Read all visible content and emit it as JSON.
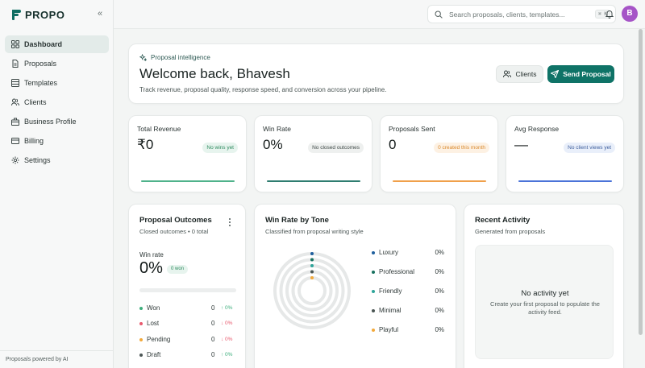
{
  "brand": {
    "name": "PROPO",
    "collapse_icon": "«"
  },
  "sidebar": {
    "items": [
      {
        "label": "Dashboard",
        "icon": "grid-icon",
        "active": true
      },
      {
        "label": "Proposals",
        "icon": "file-icon",
        "active": false
      },
      {
        "label": "Templates",
        "icon": "template-icon",
        "active": false
      },
      {
        "label": "Clients",
        "icon": "users-icon",
        "active": false
      },
      {
        "label": "Business Profile",
        "icon": "building-icon",
        "active": false
      },
      {
        "label": "Billing",
        "icon": "card-icon",
        "active": false
      },
      {
        "label": "Settings",
        "icon": "gear-icon",
        "active": false
      }
    ],
    "footer": "Proposals powered by AI"
  },
  "topbar": {
    "search_placeholder": "Search proposals, clients, templates...",
    "shortcut": "⌘ K",
    "avatar_initial": "B"
  },
  "hero": {
    "kicker": "Proposal intelligence",
    "title": "Welcome back, Bhavesh",
    "subtitle": "Track revenue, proposal quality, response speed, and conversion across your pipeline.",
    "clients_button": "Clients",
    "send_button": "Send Proposal"
  },
  "stats": [
    {
      "label": "Total Revenue",
      "value": "₹0",
      "pill": "No wins yet",
      "pill_style": "green",
      "line_color": "#4fb28b"
    },
    {
      "label": "Win Rate",
      "value": "0%",
      "pill": "No closed outcomes",
      "pill_style": "gray",
      "line_color": "#2f7d70"
    },
    {
      "label": "Proposals Sent",
      "value": "0",
      "pill": "0 created this month",
      "pill_style": "orange",
      "line_color": "#f0a04b"
    },
    {
      "label": "Avg Response",
      "value": "—",
      "pill": "No client views yet",
      "pill_style": "blue",
      "line_color": "#4b73d8"
    }
  ],
  "outcomes": {
    "title": "Proposal Outcomes",
    "subtitle": "Closed outcomes • 0 total",
    "win_rate_label": "Win rate",
    "win_rate_value": "0%",
    "won_pill": "0 won",
    "rows": [
      {
        "name": "Won",
        "count": "0",
        "delta": "↑ 0%",
        "dot": "#3dae7c",
        "delta_color": "#3dae7c"
      },
      {
        "name": "Lost",
        "count": "0",
        "delta": "↓ 0%",
        "dot": "#e85a6e",
        "delta_color": "#e85a6e"
      },
      {
        "name": "Pending",
        "count": "0",
        "delta": "↓ 0%",
        "dot": "#f2a93b",
        "delta_color": "#e85a6e"
      },
      {
        "name": "Draft",
        "count": "0",
        "delta": "↑ 0%",
        "dot": "#4d5756",
        "delta_color": "#3dae7c"
      }
    ]
  },
  "tone": {
    "title": "Win Rate by Tone",
    "subtitle": "Classified from proposal writing style",
    "rows": [
      {
        "name": "Luxury",
        "pct": "0%",
        "dot": "#1f5f9e"
      },
      {
        "name": "Professional",
        "pct": "0%",
        "dot": "#17715f"
      },
      {
        "name": "Friendly",
        "pct": "0%",
        "dot": "#2fa59a"
      },
      {
        "name": "Minimal",
        "pct": "0%",
        "dot": "#4a5553"
      },
      {
        "name": "Playful",
        "pct": "0%",
        "dot": "#f2a93b"
      }
    ]
  },
  "activity": {
    "title": "Recent Activity",
    "subtitle": "Generated from proposals",
    "empty_title": "No activity yet",
    "empty_sub": "Create your first proposal to populate the activity feed."
  },
  "colors": {
    "accent": "#0f7367",
    "avatar": "#a654c7"
  }
}
